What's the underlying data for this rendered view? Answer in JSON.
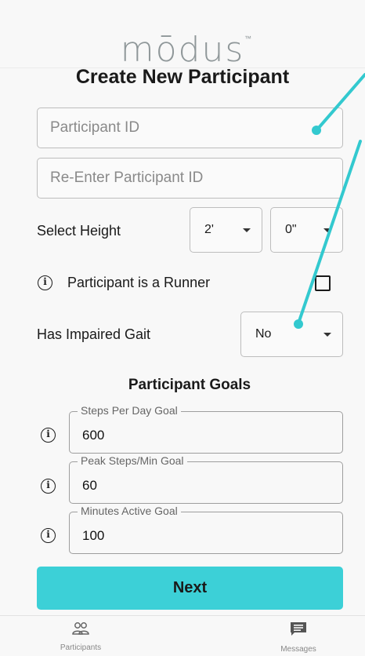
{
  "header": {
    "logo_text": "mōdus",
    "logo_tm": "™",
    "title": "Create New Participant"
  },
  "form": {
    "participant_id_placeholder": "Participant ID",
    "reenter_id_placeholder": "Re-Enter Participant ID",
    "height_label": "Select Height",
    "height_feet": "2'",
    "height_inches": "0\"",
    "runner_label": "Participant is a Runner",
    "runner_checked": false,
    "gait_label": "Has Impaired Gait",
    "gait_value": "No"
  },
  "goals": {
    "section_title": "Participant Goals",
    "items": [
      {
        "label": "Steps Per Day Goal",
        "value": "600"
      },
      {
        "label": "Peak Steps/Min Goal",
        "value": "60"
      },
      {
        "label": "Minutes Active Goal",
        "value": "100"
      }
    ]
  },
  "next_label": "Next",
  "tabbar": {
    "participants": "Participants",
    "messages": "Messages"
  },
  "colors": {
    "accent": "#3cd0d7",
    "annotation": "#33c9cf"
  },
  "icons": {
    "info": "info-icon",
    "participants": "people-icon",
    "messages": "chat-icon"
  }
}
